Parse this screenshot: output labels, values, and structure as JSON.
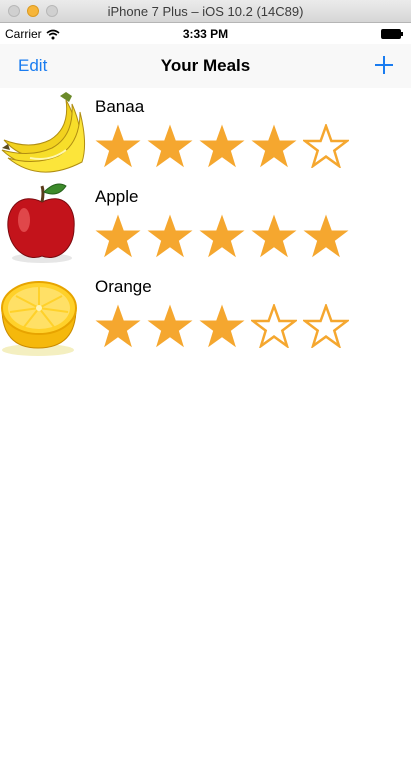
{
  "window": {
    "title": "iPhone 7 Plus – iOS 10.2 (14C89)"
  },
  "status_bar": {
    "carrier": "Carrier",
    "time": "3:33 PM"
  },
  "nav": {
    "left_button": "Edit",
    "title": "Your Meals",
    "right_icon": "plus-icon"
  },
  "colors": {
    "tint": "#1a7cf0",
    "star": "#f5a72f"
  },
  "meals": [
    {
      "name": "Banaa",
      "photo": "banana-photo",
      "rating": 4,
      "max_rating": 5
    },
    {
      "name": "Apple",
      "photo": "apple-photo",
      "rating": 5,
      "max_rating": 5
    },
    {
      "name": "Orange",
      "photo": "orange-photo",
      "rating": 3,
      "max_rating": 5
    }
  ]
}
